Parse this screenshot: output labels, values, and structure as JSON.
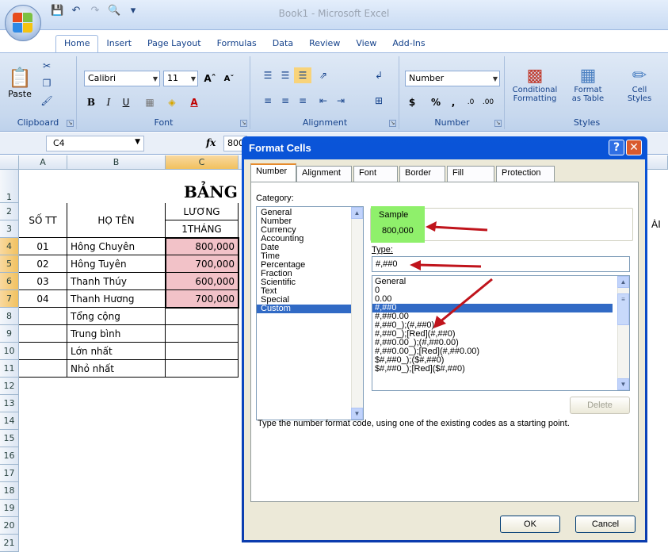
{
  "window": {
    "title": "Book1 - Microsoft Excel"
  },
  "ribbon_tabs": [
    "Home",
    "Insert",
    "Page Layout",
    "Formulas",
    "Data",
    "Review",
    "View",
    "Add-Ins"
  ],
  "ribbon": {
    "paste_label": "Paste",
    "font_name": "Calibri",
    "font_size": "11",
    "number_format": "Number",
    "conditional_formatting": "Conditional\nFormatting",
    "format_as_table": "Format\nas Table",
    "cell_styles": "Cell\nStyles",
    "groups": {
      "clipboard": "Clipboard",
      "font": "Font",
      "alignment": "Alignment",
      "number": "Number",
      "styles": "Styles"
    }
  },
  "formula_bar": {
    "name_box": "C4",
    "fx": "fx",
    "value": "800000"
  },
  "grid": {
    "columns": [
      "A",
      "B",
      "C"
    ],
    "selected_column": "C",
    "rows": [
      "1",
      "2",
      "3",
      "4",
      "5",
      "6",
      "7",
      "8",
      "9",
      "10",
      "11",
      "12",
      "13",
      "14",
      "15",
      "16",
      "17",
      "18",
      "19",
      "20",
      "21"
    ],
    "title": "BẢNG",
    "header_stt": "SỐ TT",
    "header_name": "HỌ TÊN",
    "header_salary_1": "LƯƠNG",
    "header_salary_2": "1THÁNG",
    "right_edge_text": "ÀI",
    "data_rows": [
      {
        "stt": "01",
        "name": "Hông Chuyên",
        "salary": "800,000"
      },
      {
        "stt": "02",
        "name": "Hông Tuyên",
        "salary": "700,000"
      },
      {
        "stt": "03",
        "name": "Thanh Thúy",
        "salary": "600,000"
      },
      {
        "stt": "04",
        "name": "Thanh Hương",
        "salary": "700,000"
      }
    ],
    "summary_rows": [
      "Tổng cộng",
      "Trung bình",
      "Lớn nhất",
      "Nhỏ nhất"
    ]
  },
  "dialog": {
    "title": "Format Cells",
    "tabs": [
      "Number",
      "Alignment",
      "Font",
      "Border",
      "Fill",
      "Protection"
    ],
    "category_label": "Category:",
    "categories": [
      "General",
      "Number",
      "Currency",
      "Accounting",
      "Date",
      "Time",
      "Percentage",
      "Fraction",
      "Scientific",
      "Text",
      "Special",
      "Custom"
    ],
    "selected_category": "Custom",
    "sample_label": "Sample",
    "sample_value": "800,000",
    "type_label": "Type:",
    "type_value": "#,##0",
    "type_options": [
      "General",
      "0",
      "0.00",
      "#,##0",
      "#,##0.00",
      "#,##0_);(#,##0)",
      "#,##0_);[Red](#,##0)",
      "#,##0.00_);(#,##0.00)",
      "#,##0.00_);[Red](#,##0.00)",
      "$#,##0_);($#,##0)",
      "$#,##0_);[Red]($#,##0)"
    ],
    "selected_type": "#,##0",
    "delete_label": "Delete",
    "description": "Type the number format code, using one of the existing codes as a starting point.",
    "ok_label": "OK",
    "cancel_label": "Cancel"
  },
  "colors": {
    "accent_green": "#8ff06b",
    "arrow_red": "#c0141c",
    "salary_fill": "#f2c2c8",
    "selection_blue": "#316ac5"
  }
}
